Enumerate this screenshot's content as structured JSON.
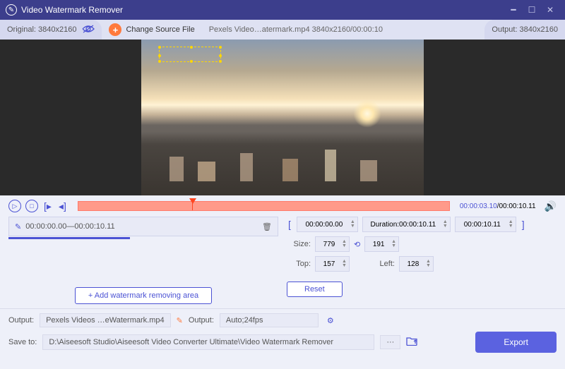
{
  "title": "Video Watermark Remover",
  "toolbar": {
    "original_label": "Original: 3840x2160",
    "change_source": "Change Source File",
    "file_info": "Pexels Video…atermark.mp4    3840x2160/00:00:10",
    "output_label": "Output: 3840x2160"
  },
  "timeline": {
    "current": "00:00:03.10",
    "sep": "/",
    "total": "00:00:10.11"
  },
  "segment": {
    "start": "00:00:00.00",
    "dash": " — ",
    "end": "00:00:10.11"
  },
  "add_area": "Add watermark removing area",
  "params": {
    "range_start": "00:00:00.00",
    "duration_label": "Duration:00:00:10.11",
    "range_end": "00:00:10.11",
    "size_label": "Size:",
    "size_w": "779",
    "size_h": "191",
    "top_label": "Top:",
    "top_val": "157",
    "left_label": "Left:",
    "left_val": "128",
    "reset": "Reset"
  },
  "bottom": {
    "output_label": "Output:",
    "output_file": "Pexels Videos …eWatermark.mp4",
    "output2_label": "Output:",
    "output2_val": "Auto;24fps",
    "saveto_label": "Save to:",
    "saveto_path": "D:\\Aiseesoft Studio\\Aiseesoft Video Converter Ultimate\\Video Watermark Remover",
    "dots": "···",
    "export": "Export"
  }
}
